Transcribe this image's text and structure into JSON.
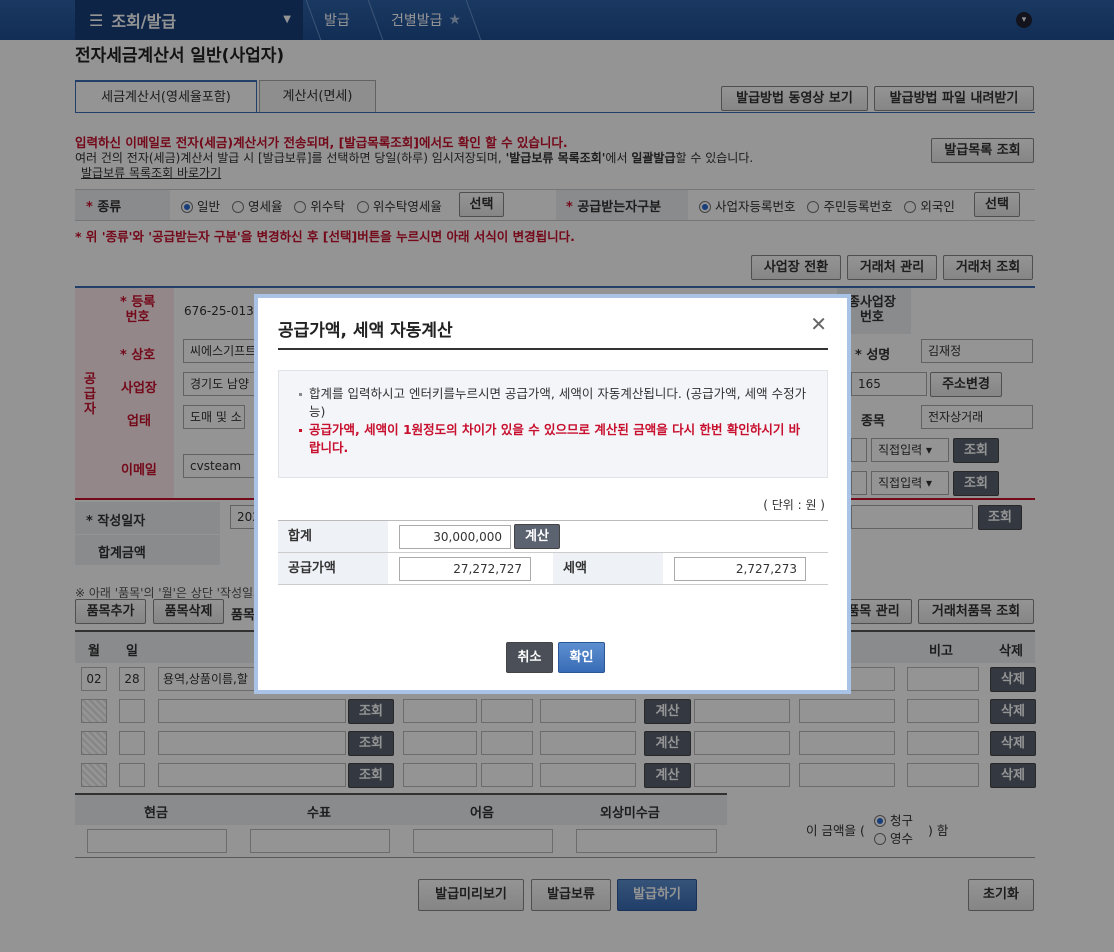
{
  "topnav": {
    "menu_label": "조회/발급",
    "crumb1": "발급",
    "crumb2": "건별발급"
  },
  "page": {
    "title": "전자세금계산서 일반(사업자)",
    "tabs": [
      "세금계산서(영세율포함)",
      "계산서(면세)"
    ],
    "video_button": "발급방법 동영상 보기",
    "file_button": "발급방법 파일 내려받기",
    "notice_red": "입력하신 이메일로 전자(세금)계산서가 전송되며, [발급목록조회]에서도 확인 할 수 있습니다.",
    "notice_2a": "여러 건의 전자(세금)계산서 발급 시 [발급보류]를 선택하면 당일(하루) 임시저장되며, ",
    "notice_2b": "'발급보류 목록조회'",
    "notice_2c": "에서 ",
    "notice_2d": "일괄발급",
    "notice_2e": "할 수 있습니다.",
    "notice_link": "발급보류 목록조회 바로가기",
    "list_button": "발급목록 조회",
    "type_label": "* 종류",
    "type_options": [
      "일반",
      "영세율",
      "위수탁",
      "위수탁영세율"
    ],
    "select_button": "선택",
    "receiver_label": "* 공급받는자구분",
    "receiver_options": [
      "사업자등록번호",
      "주민등록번호",
      "외국인"
    ],
    "select_button2": "선택",
    "change_notice": "* 위 '종류'와 '공급받는자 구분'을 변경하신 후 [선택]버튼을 누르시면 아래 서식이 변경됩니다.",
    "biz_switch": "사업장 전환",
    "partner_manage": "거래처 관리",
    "partner_lookup": "거래처 조회"
  },
  "supplier": {
    "side_label": "공급자",
    "reg_label": "* 등록\n번호",
    "reg_value": "676-25-01376",
    "name_label": "* 상호",
    "name_value": "씨에스기프트",
    "addr_label": "사업장",
    "addr_value": "경기도 남양",
    "biz_label": "업태",
    "biz_value": "도매 및 소",
    "email_label": "이메일",
    "email_value": "cvsteam",
    "r_sub_label": "종사업장\n번호",
    "r_name_label": "* 성명",
    "r_name_value": "김재정",
    "r_addr_value": "165",
    "addr_change": "주소변경",
    "item_label": "종목",
    "item_value": "전자상거래",
    "direct_input": "직접입력",
    "lookup": "조회"
  },
  "date_row": {
    "label": "* 작성일자",
    "value": "202",
    "total_label": "합계금액",
    "lookup": "조회"
  },
  "items": {
    "note": "※ 아래 '품목'의 '월'은 상단 '작성일자",
    "add": "품목추가",
    "delete": "품목삭제",
    "partial": "품목",
    "item_manage": "품목 관리",
    "partner_item": "거래처품목 조회",
    "headers": {
      "month": "월",
      "day": "일",
      "note": "비고",
      "del": "삭제"
    },
    "row1": {
      "month": "02",
      "day": "28",
      "name": "용역,상품이름,할"
    },
    "lookup": "조회",
    "calc": "계산",
    "del": "삭제"
  },
  "payment": {
    "cash": "현금",
    "check": "수표",
    "note": "어음",
    "credit": "외상미수금",
    "amount_pre": "이 금액을 (",
    "claim": "청구",
    "receipt": "영수",
    "amount_post": ") 함"
  },
  "actions": {
    "preview": "발급미리보기",
    "hold": "발급보류",
    "issue": "발급하기",
    "reset": "초기화"
  },
  "modal": {
    "title": "공급가액, 세액 자동계산",
    "info1": "합계를 입력하시고 엔터키를누르시면 공급가액, 세액이 자동계산됩니다. (공급가액, 세액 수정가능)",
    "info2": "공급가액, 세액이 1원정도의 차이가 있을 수 있으므로 계산된 금액을 다시 한번 확인하시기 바랍니다.",
    "unit": "( 단위 : 원 )",
    "total_label": "합계",
    "total_value": "30,000,000",
    "calc_button": "계산",
    "supply_label": "공급가액",
    "supply_value": "27,272,727",
    "tax_label": "세액",
    "tax_value": "2,727,273",
    "cancel": "취소",
    "confirm": "확인"
  },
  "colors": {
    "nav": "#1f4f93",
    "accent": "#3a6db5",
    "red": "#c8102e"
  }
}
